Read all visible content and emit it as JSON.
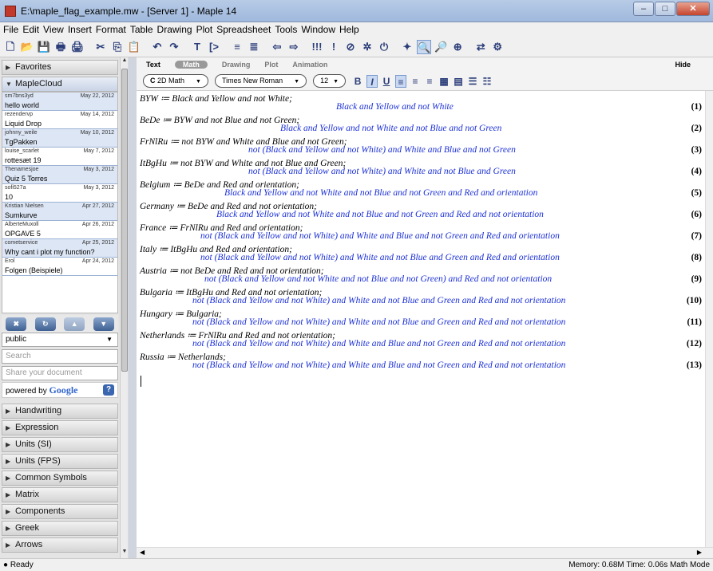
{
  "window": {
    "title": "E:\\maple_flag_example.mw - [Server 1] - Maple 14",
    "controls": [
      "–",
      "□",
      "✕"
    ]
  },
  "menu": [
    "File",
    "Edit",
    "View",
    "Insert",
    "Format",
    "Table",
    "Drawing",
    "Plot",
    "Spreadsheet",
    "Tools",
    "Window",
    "Help"
  ],
  "toolbar": [
    {
      "name": "new-icon",
      "glyph": "🗋"
    },
    {
      "name": "open-icon",
      "glyph": "📂"
    },
    {
      "name": "save-icon",
      "glyph": "💾"
    },
    {
      "name": "print-icon",
      "glyph": "🖶"
    },
    {
      "name": "print-preview-icon",
      "glyph": "🖨"
    },
    {
      "name": "cut-icon",
      "glyph": "✂"
    },
    {
      "name": "copy-icon",
      "glyph": "⎘"
    },
    {
      "name": "paste-icon",
      "glyph": "📋"
    },
    {
      "name": "undo-icon",
      "glyph": "↶"
    },
    {
      "name": "redo-icon",
      "glyph": "↷"
    },
    {
      "name": "text-mode-icon",
      "glyph": "T"
    },
    {
      "name": "math-input-icon",
      "glyph": "[>"
    },
    {
      "name": "section-icon",
      "glyph": "≡"
    },
    {
      "name": "unsection-icon",
      "glyph": "≣"
    },
    {
      "name": "back-icon",
      "glyph": "⇦"
    },
    {
      "name": "forward-icon",
      "glyph": "⇨"
    },
    {
      "name": "execute-all-icon",
      "glyph": "!!!"
    },
    {
      "name": "execute-icon",
      "glyph": "!"
    },
    {
      "name": "stop-icon",
      "glyph": "⊘"
    },
    {
      "name": "debug-icon",
      "glyph": "✲"
    },
    {
      "name": "restart-icon",
      "glyph": "⏻"
    },
    {
      "name": "expand-icon",
      "glyph": "✦"
    },
    {
      "name": "zoom-100-icon",
      "glyph": "🔍"
    },
    {
      "name": "zoom-150-icon",
      "glyph": "🔎"
    },
    {
      "name": "zoom-200-icon",
      "glyph": "⊕"
    },
    {
      "name": "pin-icon",
      "glyph": "⇄"
    },
    {
      "name": "help-icon",
      "glyph": "⚙"
    }
  ],
  "sidebar": {
    "favorites": "Favorites",
    "maplecloud": "MapleCloud",
    "cloud_items": [
      {
        "user": "sm7bns3yd",
        "date": "May 22, 2012",
        "title": "hello world"
      },
      {
        "user": "rezendervp",
        "date": "May 14, 2012",
        "title": "Liquid Drop"
      },
      {
        "user": "johnny_weile",
        "date": "May 10, 2012",
        "title": "TgPakken"
      },
      {
        "user": "louise_scarlet",
        "date": "May 7, 2012",
        "title": "rottesæt 19"
      },
      {
        "user": "Thenamesjoe",
        "date": "May 3, 2012",
        "title": "Quiz 5 Torres"
      },
      {
        "user": "sofi527a",
        "date": "May 3, 2012",
        "title": "10"
      },
      {
        "user": "Kristian Nielsen",
        "date": "Apr 27, 2012",
        "title": "Sumkurve"
      },
      {
        "user": "AlberteMuxoll",
        "date": "Apr 26, 2012",
        "title": "OPGAVE 5"
      },
      {
        "user": "cometservice",
        "date": "Apr 25, 2012",
        "title": "Why cant i plot my function?"
      },
      {
        "user": "Erol",
        "date": "Apr 24, 2012",
        "title": "Folgen (Beispiele)"
      }
    ],
    "group": "public",
    "search_placeholder": "Search",
    "share_placeholder": "Share your document",
    "powered_by": "powered by",
    "google": "Google",
    "palettes": [
      "Handwriting",
      "Expression",
      "Units (SI)",
      "Units (FPS)",
      "Common Symbols",
      "Matrix",
      "Components",
      "Greek",
      "Arrows"
    ]
  },
  "context": {
    "tabs": [
      "Text",
      "Math",
      "Drawing",
      "Plot",
      "Animation"
    ],
    "active_tab": "Math",
    "hide": "Hide",
    "mode": "2D Math",
    "mode_letter": "C",
    "font": "Times New Roman",
    "size": "12",
    "bold": "B",
    "italic": "I",
    "underline": "U"
  },
  "document": [
    {
      "input": "BYW ≔ Black and Yellow and not White;",
      "output": "Black and Yellow and not White",
      "label": "(1)"
    },
    {
      "input": "BeDe ≔ BYW and not Blue and not Green;",
      "output": "Black and Yellow and not White and not Blue and not Green",
      "label": "(2)"
    },
    {
      "input": "FrNlRu ≔ not BYW and White and Blue and not Green;",
      "output": "not (Black and Yellow and not White) and White and Blue and not Green",
      "label": "(3)"
    },
    {
      "input": "ItBgHu ≔ not BYW and White and not Blue and Green;",
      "output": "not (Black and Yellow and not White) and White and not Blue and Green",
      "label": "(4)"
    },
    {
      "input": "Belgium ≔ BeDe and Red and orientation;",
      "output": "Black and Yellow and not White and not Blue and not Green and Red and orientation",
      "label": "(5)"
    },
    {
      "input": "Germany ≔ BeDe and Red and not orientation;",
      "output": "Black and Yellow and not White and not Blue and not Green and Red and not orientation",
      "label": "(6)"
    },
    {
      "input": "France ≔ FrNlRu and Red and orientation;",
      "output": "not (Black and Yellow and not White) and White and Blue and not Green and Red and orientation",
      "label": "(7)"
    },
    {
      "input": "Italy ≔ ItBgHu and Red and orientation;",
      "output": "not (Black and Yellow and not White) and White and not Blue and Green and Red and orientation",
      "label": "(8)"
    },
    {
      "input": "Austria ≔ not BeDe and Red and not orientation;",
      "output": "not (Black and Yellow and not White and not Blue and not Green) and Red and not orientation",
      "label": "(9)"
    },
    {
      "input": "Bulgaria ≔ ItBgHu and Red and not orientation;",
      "output": "not (Black and Yellow and not White) and White and not Blue and Green and Red and not orientation",
      "label": "(10)"
    },
    {
      "input": "Hungary ≔ Bulgaria;",
      "output": "not (Black and Yellow and not White) and White and not Blue and Green and Red and not orientation",
      "label": "(11)"
    },
    {
      "input": "Netherlands ≔ FrNlRu and Red and not orientation;",
      "output": "not (Black and Yellow and not White) and White and Blue and not Green and Red and not orientation",
      "label": "(12)"
    },
    {
      "input": "Russia ≔ Netherlands;",
      "output": "not (Black and Yellow and not White) and White and Blue and not Green and Red and not orientation",
      "label": "(13)"
    }
  ],
  "status": {
    "left": "● Ready",
    "right": "Memory: 0.68M  Time: 0.06s  Math Mode"
  }
}
